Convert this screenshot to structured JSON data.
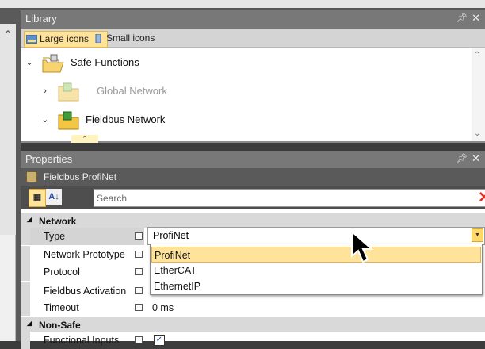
{
  "library": {
    "title": "Library",
    "pin_icon": "pin-icon",
    "close_icon": "close-icon",
    "toolbar": {
      "large_icons": "Large icons",
      "small_icons": "Small icons"
    },
    "tree": [
      {
        "label": "Safe Functions",
        "expanded": true
      },
      {
        "label": "Global Network",
        "expanded": false,
        "dimmed": true
      },
      {
        "label": "Fieldbus Network",
        "expanded": true
      }
    ]
  },
  "properties": {
    "title": "Properties",
    "object_name": "Fieldbus ProfiNet",
    "search_placeholder": "Search",
    "categories": [
      {
        "name": "Network",
        "rows": [
          {
            "name": "Type",
            "value": "ProfiNet",
            "selected": true
          },
          {
            "name": "Network Prototype",
            "value": ""
          },
          {
            "name": "Protocol",
            "value": ""
          },
          {
            "name": "Fieldbus Activation",
            "value": ""
          },
          {
            "name": "Timeout",
            "value": "0 ms"
          }
        ]
      },
      {
        "name": "Non-Safe",
        "rows": [
          {
            "name": "Functional Inputs",
            "value": "",
            "checked": true
          }
        ]
      }
    ],
    "type_dropdown": {
      "selected": "ProfiNet",
      "options": [
        "ProfiNet",
        "EtherCAT",
        "EthernetIP"
      ]
    }
  },
  "colors": {
    "selection": "#ffe39a",
    "panel_title": "#787878",
    "category_row": "#d9d9d9",
    "clear_icon": "#e03020"
  }
}
